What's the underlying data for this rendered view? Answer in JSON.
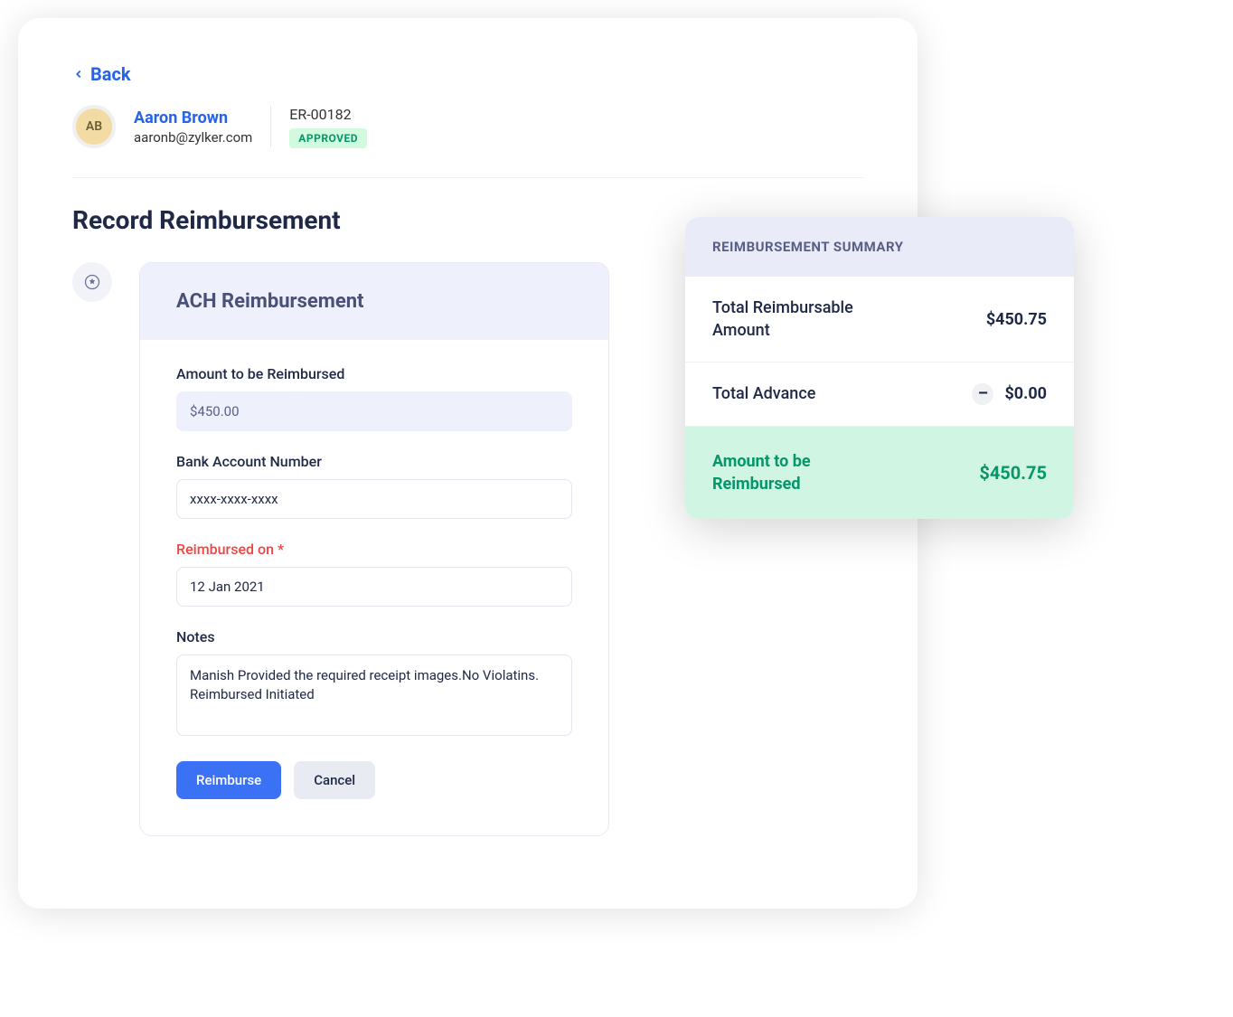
{
  "header": {
    "back_label": "Back"
  },
  "user": {
    "initials": "AB",
    "name": "Aaron Brown",
    "email": "aaronb@zylker.com",
    "ref_id": "ER-00182",
    "status": "APPROVED"
  },
  "page": {
    "title": "Record Reimbursement"
  },
  "form": {
    "title": "ACH Reimbursement",
    "amount_label": "Amount to be Reimbursed",
    "amount_value": "$450.00",
    "bank_label": "Bank Account Number",
    "bank_value": "xxxx-xxxx-xxxx",
    "date_label": "Reimbursed on",
    "date_value": "12 Jan 2021",
    "notes_label": "Notes",
    "notes_value": "Manish Provided the required receipt images.No Violatins. Reimbursed Initiated",
    "reimburse_btn": "Reimburse",
    "cancel_btn": "Cancel"
  },
  "summary": {
    "title": "REIMBURSEMENT SUMMARY",
    "total_reimbursable_label": "Total Reimbursable Amount",
    "total_reimbursable_value": "$450.75",
    "total_advance_label": "Total Advance",
    "total_advance_value": "$0.00",
    "amount_label": "Amount to be Reimbursed",
    "amount_value": "$450.75"
  }
}
